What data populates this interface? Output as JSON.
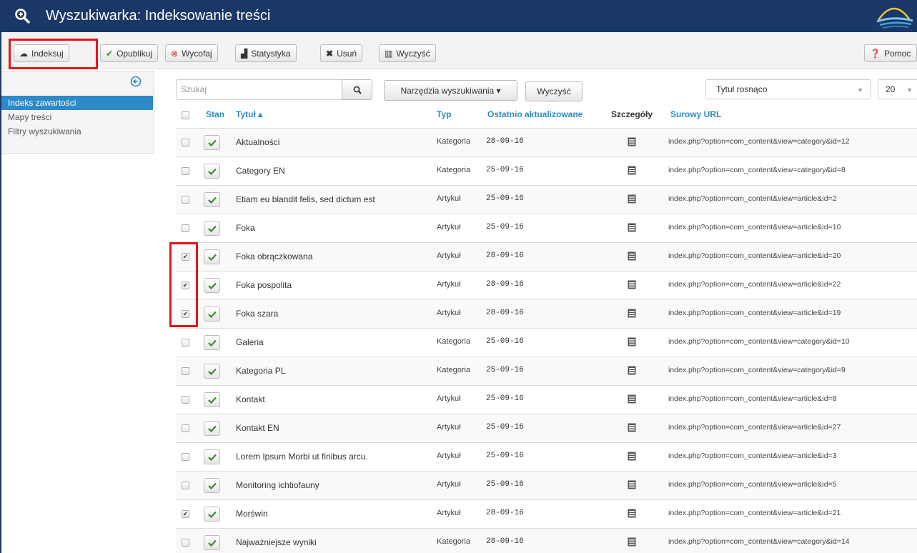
{
  "header": {
    "title": "Wyszukiwarka: Indeksowanie treści"
  },
  "toolbar": {
    "buttons": [
      {
        "label": "Indeksuj",
        "icon": "cloud-upload-icon"
      },
      {
        "label": "Opublikuj",
        "icon": "check-icon"
      },
      {
        "label": "Wycofaj",
        "icon": "remove-circle-icon"
      },
      {
        "label": "Statystyka",
        "icon": "chart-icon"
      },
      {
        "label": "Usuń",
        "icon": "x-icon"
      },
      {
        "label": "Wyczyść",
        "icon": "trash-icon"
      }
    ],
    "help": "Pomoc"
  },
  "sidebar": {
    "items": [
      {
        "label": "Indeks zawartości",
        "active": true
      },
      {
        "label": "Mapy treści",
        "active": false
      },
      {
        "label": "Filtry wyszukiwania",
        "active": false
      }
    ]
  },
  "filters": {
    "search_placeholder": "Szukaj",
    "tools_label": "Narzędzia wyszukiwania ▾",
    "clear_label": "Wyczyść",
    "sort_value": "Tytuł rosnąco",
    "limit_value": "20"
  },
  "table": {
    "headers": {
      "state": "Stan",
      "title": "Tytuł ▴",
      "type": "Typ",
      "modified": "Ostatnio aktualizowane",
      "details": "Szczegóły",
      "url": "Surowy URL"
    },
    "rows": [
      {
        "checked": false,
        "title": "Aktualności",
        "type": "Kategoria",
        "date": "28-09-16",
        "url": "index.php?option=com_content&view=category&id=12"
      },
      {
        "checked": false,
        "title": "Category EN",
        "type": "Kategoria",
        "date": "25-09-16",
        "url": "index.php?option=com_content&view=category&id=8"
      },
      {
        "checked": false,
        "title": "Etiam eu blandit felis, sed dictum est",
        "type": "Artykuł",
        "date": "25-09-16",
        "url": "index.php?option=com_content&view=article&id=2"
      },
      {
        "checked": false,
        "title": "Foka",
        "type": "Artykuł",
        "date": "25-09-16",
        "url": "index.php?option=com_content&view=article&id=10"
      },
      {
        "checked": true,
        "title": "Foka obrączkowana",
        "type": "Artykuł",
        "date": "28-09-16",
        "url": "index.php?option=com_content&view=article&id=20"
      },
      {
        "checked": true,
        "title": "Foka pospolita",
        "type": "Artykuł",
        "date": "28-09-16",
        "url": "index.php?option=com_content&view=article&id=22"
      },
      {
        "checked": true,
        "title": "Foka szara",
        "type": "Artykuł",
        "date": "28-09-16",
        "url": "index.php?option=com_content&view=article&id=19"
      },
      {
        "checked": false,
        "title": "Galeria",
        "type": "Kategoria",
        "date": "25-09-16",
        "url": "index.php?option=com_content&view=category&id=10"
      },
      {
        "checked": false,
        "title": "Kategoria PL",
        "type": "Kategoria",
        "date": "25-09-16",
        "url": "index.php?option=com_content&view=category&id=9"
      },
      {
        "checked": false,
        "title": "Kontakt",
        "type": "Artykuł",
        "date": "25-09-16",
        "url": "index.php?option=com_content&view=article&id=8"
      },
      {
        "checked": false,
        "title": "Kontakt EN",
        "type": "Artykuł",
        "date": "25-09-16",
        "url": "index.php?option=com_content&view=article&id=27"
      },
      {
        "checked": false,
        "title": "Lorem Ipsum Morbi ut finibus arcu.",
        "type": "Artykuł",
        "date": "25-09-16",
        "url": "index.php?option=com_content&view=article&id=3"
      },
      {
        "checked": false,
        "title": "Monitoring ichtiofauny",
        "type": "Artykuł",
        "date": "25-09-16",
        "url": "index.php?option=com_content&view=article&id=5"
      },
      {
        "checked": true,
        "title": "Morświn",
        "type": "Artykuł",
        "date": "28-09-16",
        "url": "index.php?option=com_content&view=article&id=21"
      },
      {
        "checked": false,
        "title": "Najważniejsze wyniki",
        "type": "Kategoria",
        "date": "28-09-16",
        "url": "index.php?option=com_content&view=category&id=14"
      }
    ]
  },
  "colors": {
    "header_bg": "#1a3867",
    "accent": "#2d8ac7",
    "highlight": "#e3161b",
    "published": "#3c8a2e"
  }
}
